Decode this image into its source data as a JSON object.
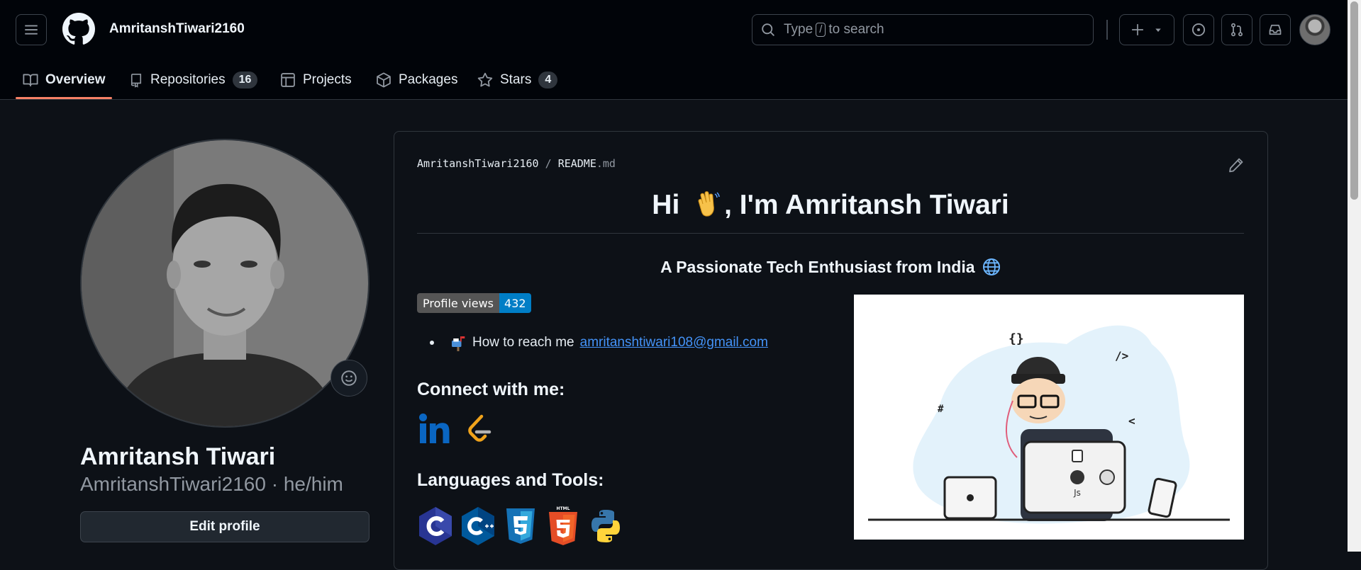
{
  "header": {
    "username": "AmritanshTiwari2160",
    "search_prefix": "Type",
    "search_key": "/",
    "search_suffix": "to search"
  },
  "tabs": [
    {
      "label": "Overview",
      "icon": "book-icon",
      "active": true
    },
    {
      "label": "Repositories",
      "icon": "repo-icon",
      "count": "16"
    },
    {
      "label": "Projects",
      "icon": "table-icon"
    },
    {
      "label": "Packages",
      "icon": "package-icon"
    },
    {
      "label": "Stars",
      "icon": "star-icon",
      "count": "4"
    }
  ],
  "profile": {
    "full_name": "Amritansh Tiwari",
    "login_line": "AmritanshTiwari2160 · he/him",
    "edit_label": "Edit profile"
  },
  "readme": {
    "path_user": "AmritanshTiwari2160",
    "path_sep": "/",
    "path_file": "README",
    "path_ext": ".md",
    "title_hi": "Hi",
    "title_rest": ", I'm Amritansh Tiwari",
    "subtitle": "A Passionate Tech Enthusiast from India",
    "badge_label": "Profile views",
    "badge_value": "432",
    "reach_text": "How to reach me",
    "reach_email": "amritanshtiwari108@gmail.com",
    "connect_heading": "Connect with me:",
    "langs_heading": "Languages and Tools:",
    "social": [
      "linkedin-icon",
      "leetcode-icon"
    ],
    "tools": [
      "c-icon",
      "cplusplus-icon",
      "css3-icon",
      "html5-icon",
      "python-icon"
    ]
  },
  "colors": {
    "background": "#0d1117",
    "header": "#010409",
    "link": "#4493f8",
    "active_tab": "#f78166"
  }
}
